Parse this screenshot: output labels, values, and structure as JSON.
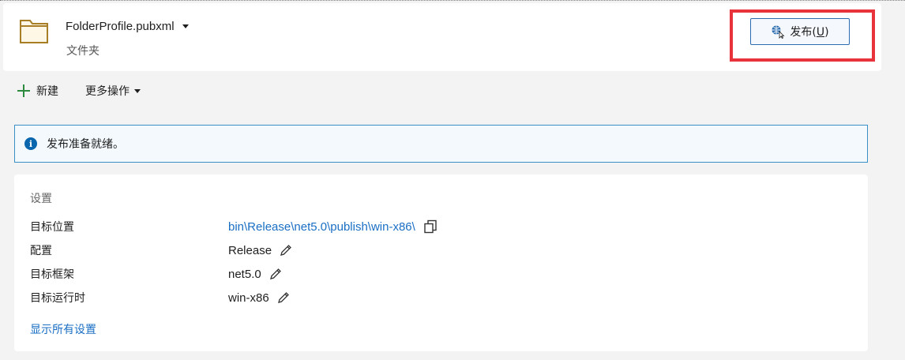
{
  "header": {
    "profile_name": "FolderProfile.pubxml",
    "profile_type": "文件夹",
    "publish_label": "发布(",
    "publish_accel": "U",
    "publish_close": ")"
  },
  "toolbar": {
    "new_label": "新建",
    "more_label": "更多操作"
  },
  "info": {
    "message": "发布准备就绪。"
  },
  "settings": {
    "title": "设置",
    "rows": [
      {
        "label": "目标位置",
        "value": "bin\\Release\\net5.0\\publish\\win-x86\\"
      },
      {
        "label": "配置",
        "value": "Release"
      },
      {
        "label": "目标框架",
        "value": "net5.0"
      },
      {
        "label": "目标运行时",
        "value": "win-x86"
      }
    ],
    "show_all": "显示所有设置"
  },
  "colors": {
    "accent": "#1a6fc4",
    "highlight": "#e8323c",
    "info_border": "#3a8fc6"
  }
}
